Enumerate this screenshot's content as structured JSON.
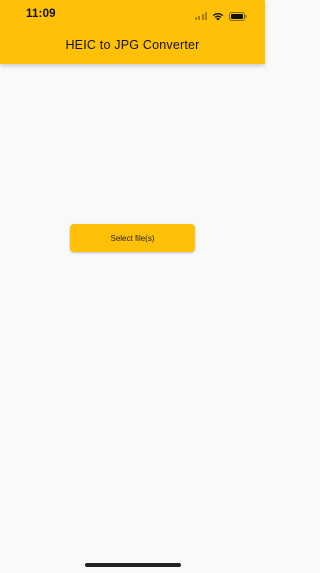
{
  "status_bar": {
    "time": "11:09",
    "icons": [
      "signal-icon",
      "wifi-icon",
      "battery-icon"
    ]
  },
  "app_bar": {
    "title": "HEIC to JPG Converter"
  },
  "main": {
    "select_button_label": "Select file(s)"
  },
  "colors": {
    "accent": "#ffc107",
    "background": "#f9f9f9",
    "text": "#111111"
  }
}
